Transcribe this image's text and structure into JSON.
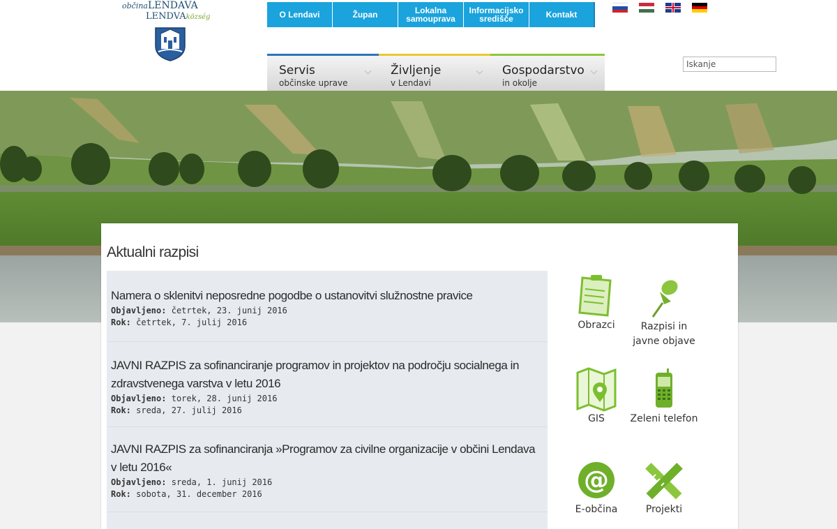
{
  "logo": {
    "line1_prefix": "občina",
    "line1": "LENDAVA",
    "line2": "LENDVA",
    "line2_suffix": "község"
  },
  "topnav": [
    {
      "label": "O Lendavi"
    },
    {
      "label": "Župan"
    },
    {
      "label": "Lokalna samouprava"
    },
    {
      "label": "Informacijsko središče"
    },
    {
      "label": "Kontakt"
    }
  ],
  "flags": [
    "slovenian-flag",
    "hungarian-flag",
    "uk-flag",
    "german-flag"
  ],
  "mainnav": [
    {
      "title": "Servis",
      "subtitle": "občinske uprave",
      "accent": "#2e75b6"
    },
    {
      "title": "Življenje",
      "subtitle": "v Lendavi",
      "accent": "#e8c832"
    },
    {
      "title": "Gospodarstvo",
      "subtitle": "in okolje",
      "accent": "#8cc63e"
    }
  ],
  "search": {
    "placeholder": "Iskanje"
  },
  "section": {
    "title": "Aktualni razpisi"
  },
  "labels": {
    "published": "Objavljeno:",
    "deadline": "Rok:"
  },
  "entries": [
    {
      "title": "Namera o sklenitvi neposredne pogodbe o ustanovitvi služnostne pravice",
      "published": "četrtek, 23. junij 2016",
      "deadline": "četrtek, 7. julij 2016"
    },
    {
      "title": "JAVNI RAZPIS za sofinanciranje programov in projektov na področju socialnega in zdravstvenega varstva v letu 2016",
      "published": "torek, 28. junij 2016",
      "deadline": "sreda, 27. julij 2016"
    },
    {
      "title": "JAVNI RAZPIS za sofinanciranja »Programov za civilne organizacije v občini Lendava v letu 2016«",
      "published": "sreda, 1. junij 2016",
      "deadline": "sobota, 31. december 2016"
    }
  ],
  "tiles": [
    {
      "label": "Obrazci",
      "icon": "form-icon"
    },
    {
      "label": "Razpisi in javne objave",
      "icon": "pushpin-icon"
    },
    {
      "label": "GIS",
      "icon": "map-icon"
    },
    {
      "label": "Zeleni telefon",
      "icon": "phone-icon"
    },
    {
      "label": "E-občina",
      "icon": "at-icon"
    },
    {
      "label": "Projekti",
      "icon": "ruler-pencil-icon"
    }
  ],
  "colors": {
    "topnav": "#1aa3dc",
    "accent_green": "#8cc63e"
  }
}
